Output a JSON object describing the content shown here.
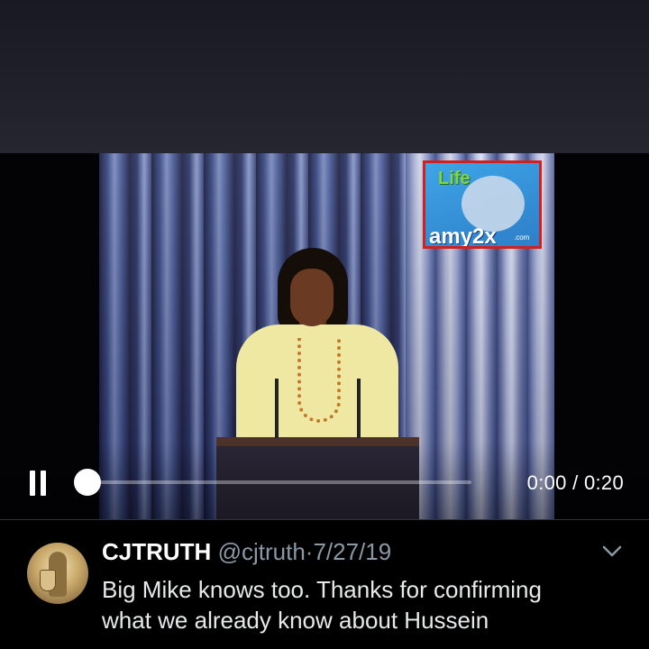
{
  "player": {
    "state": "playing",
    "current_time": "0:00",
    "time_separator": "/",
    "duration": "0:20",
    "progress": 0.0,
    "icons": {
      "play_pause": "pause-icon"
    }
  },
  "video": {
    "watermark": {
      "top_text": "Life",
      "bottom_text": "amy2x",
      "suffix": ".com"
    }
  },
  "tweet": {
    "author_name": "CJTRUTH",
    "handle": "@cjtruth",
    "dot": "·",
    "date": "7/27/19",
    "text_lines": [
      "Big Mike knows too. Thanks for confirming",
      "what we already know about Hussein"
    ],
    "icons": {
      "menu": "chevron-down-icon"
    }
  },
  "colors": {
    "background": "#000000",
    "muted_text": "#8b98a5",
    "watermark_border": "#d12020"
  }
}
